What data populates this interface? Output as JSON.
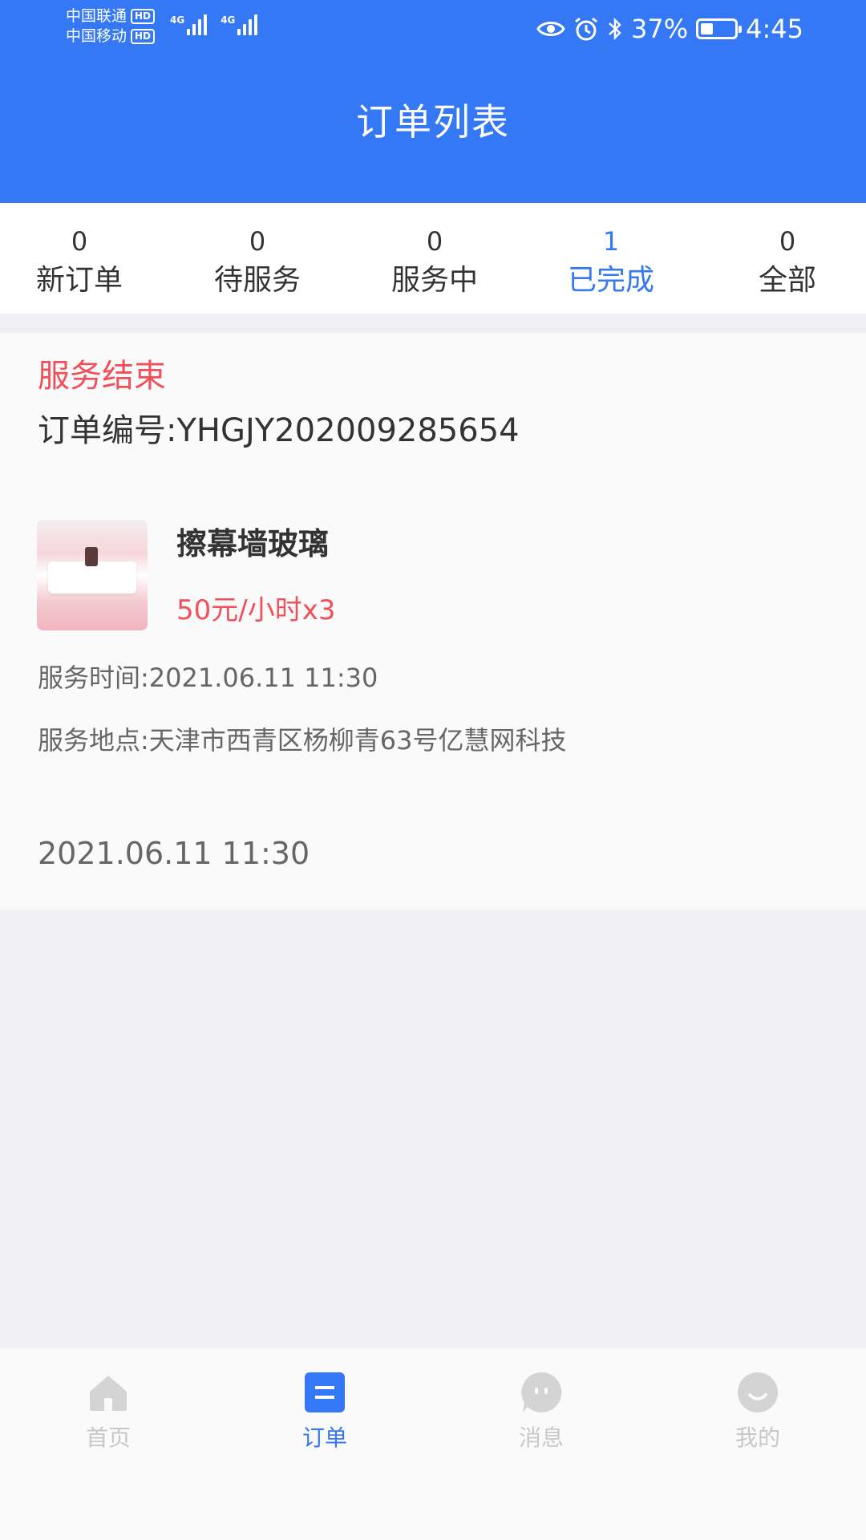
{
  "status_bar": {
    "carriers": [
      {
        "name": "中国联通",
        "badge": "HD"
      },
      {
        "name": "中国移动",
        "badge": "HD"
      }
    ],
    "signal_types": [
      "4G",
      "4G"
    ],
    "battery": "37%",
    "battery_level": 0.37,
    "time": "4:45"
  },
  "header": {
    "title": "订单列表"
  },
  "tabs": [
    {
      "count": "0",
      "label": "新订单"
    },
    {
      "count": "0",
      "label": "待服务"
    },
    {
      "count": "0",
      "label": "服务中"
    },
    {
      "count": "1",
      "label": "已完成"
    },
    {
      "count": "0",
      "label": "全部"
    }
  ],
  "active_tab": "已完成",
  "order": {
    "status": "服务结束",
    "order_no": "订单编号:YHGJY202009285654",
    "product_name": "擦幕墙玻璃",
    "price": "50元/小时x3",
    "service_time": "服务时间:2021.06.11  11:30",
    "service_address": "服务地点:天津市西青区杨柳青63号亿慧网科技",
    "footer_time": "2021.06.11  11:30"
  },
  "bottom_nav": [
    {
      "label": "首页",
      "icon": "home-icon"
    },
    {
      "label": "订单",
      "icon": "order-icon"
    },
    {
      "label": "消息",
      "icon": "message-icon"
    },
    {
      "label": "我的",
      "icon": "profile-icon"
    }
  ],
  "colors": {
    "primary": "#3478f6",
    "accent_red": "#f0505a",
    "background": "#efeff4"
  }
}
